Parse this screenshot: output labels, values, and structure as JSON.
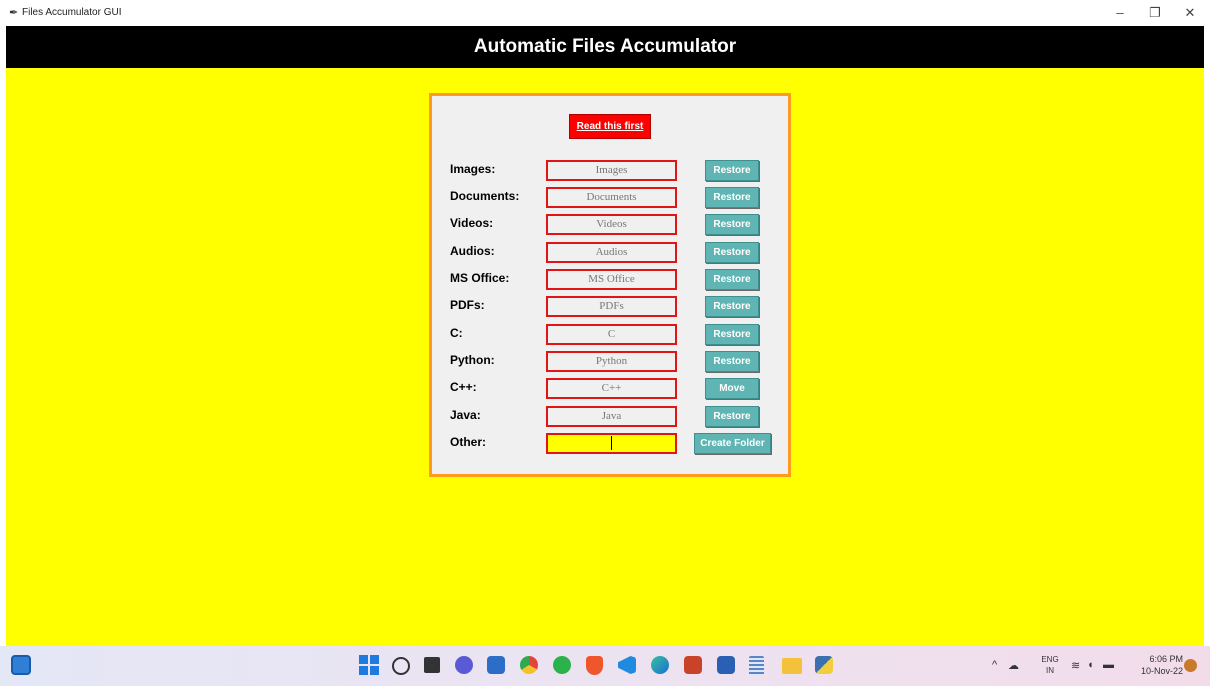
{
  "window": {
    "title": "Files Accumulator GUI",
    "controls": {
      "minimize": "–",
      "maximize": "❐",
      "close": "✕"
    }
  },
  "app": {
    "heading": "Automatic Files Accumulator",
    "read_button": "Read this first",
    "rows": [
      {
        "label": "Images:",
        "value": "Images",
        "button": "Restore"
      },
      {
        "label": "Documents:",
        "value": "Documents",
        "button": "Restore"
      },
      {
        "label": "Videos:",
        "value": "Videos",
        "button": "Restore"
      },
      {
        "label": "Audios:",
        "value": "Audios",
        "button": "Restore"
      },
      {
        "label": "MS Office:",
        "value": "MS Office",
        "button": "Restore"
      },
      {
        "label": "PDFs:",
        "value": "PDFs",
        "button": "Restore"
      },
      {
        "label": "C:",
        "value": "C",
        "button": "Restore"
      },
      {
        "label": "Python:",
        "value": "Python",
        "button": "Restore"
      },
      {
        "label": "C++:",
        "value": "C++",
        "button": "Move"
      },
      {
        "label": "Java:",
        "value": "Java",
        "button": "Restore"
      },
      {
        "label": "Other:",
        "value": "",
        "button": "Create Folder"
      }
    ],
    "colors": {
      "background": "#ffff00",
      "header": "#000000",
      "panel_border": "#ff9a1f",
      "field_border": "#e01515",
      "button": "#5fb5b3",
      "read_button": "#ff0000"
    }
  },
  "taskbar": {
    "tray": {
      "language": "ENG",
      "region": "IN",
      "time": "6:06 PM",
      "date": "10-Nov-22"
    },
    "pinned_icons": [
      "start-icon",
      "search-icon",
      "task-view-icon",
      "chat-icon",
      "store-icon",
      "chrome-icon",
      "whatsapp-icon",
      "brave-icon",
      "vscode-icon",
      "edge-icon",
      "powerpoint-icon",
      "word-icon",
      "notepad-icon",
      "file-explorer-icon",
      "python-idle-icon"
    ]
  }
}
